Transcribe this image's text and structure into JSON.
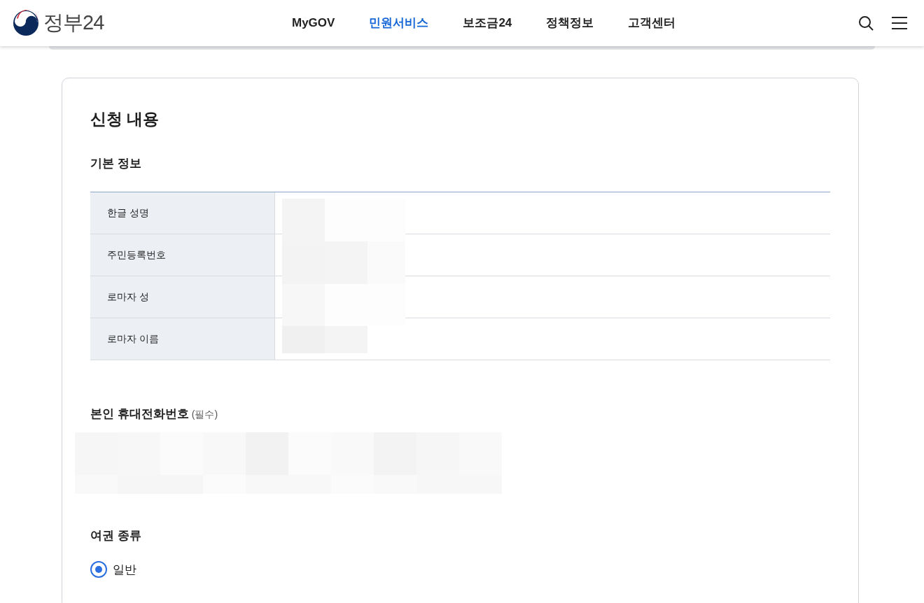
{
  "header": {
    "logo_text": "정부24",
    "nav": [
      {
        "label": "MyGOV",
        "selected": false
      },
      {
        "label": "민원서비스",
        "selected": true
      },
      {
        "label": "보조금24",
        "selected": false
      },
      {
        "label": "정책정보",
        "selected": false
      },
      {
        "label": "고객센터",
        "selected": false
      }
    ]
  },
  "form": {
    "title": "신청 내용",
    "basic_info": {
      "heading": "기본 정보",
      "rows": [
        {
          "label": "한글 성명"
        },
        {
          "label": "주민등록번호"
        },
        {
          "label": "로마자 성"
        },
        {
          "label": "로마자 이름"
        }
      ]
    },
    "phone": {
      "label": "본인 휴대전화번호",
      "required_note": "(필수)"
    },
    "passport_type": {
      "label": "여권 종류",
      "options": [
        {
          "label": "일반",
          "selected": true
        }
      ]
    }
  }
}
